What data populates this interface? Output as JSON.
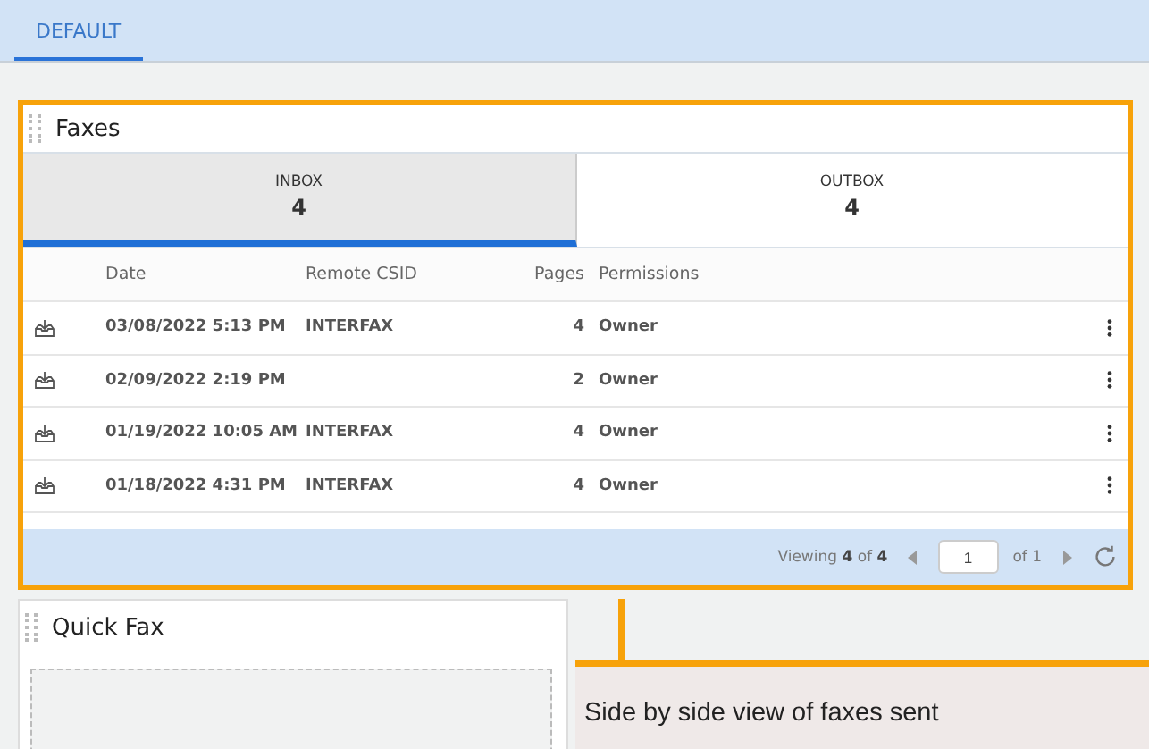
{
  "top_tabs": [
    {
      "label": "DEFAULT",
      "selected": true
    }
  ],
  "faxes": {
    "title": "Faxes",
    "tabs": [
      {
        "label": "INBOX",
        "count": "4",
        "selected": true
      },
      {
        "label": "OUTBOX",
        "count": "4",
        "selected": false
      }
    ],
    "columns": [
      "Date",
      "Remote CSID",
      "Pages",
      "Permissions"
    ],
    "rows": [
      {
        "date": "03/08/2022 5:13 PM",
        "csid": "INTERFAX",
        "pages": "4",
        "permissions": "Owner"
      },
      {
        "date": "02/09/2022 2:19 PM",
        "csid": "",
        "pages": "2",
        "permissions": "Owner"
      },
      {
        "date": "01/19/2022 10:05 AM",
        "csid": "INTERFAX",
        "pages": "4",
        "permissions": "Owner"
      },
      {
        "date": "01/18/2022 4:31 PM",
        "csid": "INTERFAX",
        "pages": "4",
        "permissions": "Owner"
      }
    ],
    "footer": {
      "viewing": "Viewing **4** of **4**",
      "page": "1",
      "of_pages": "of 1"
    }
  },
  "quick_fax": {
    "title": "Quick Fax"
  },
  "callout": {
    "text": "Side by side view of faxes sent"
  }
}
